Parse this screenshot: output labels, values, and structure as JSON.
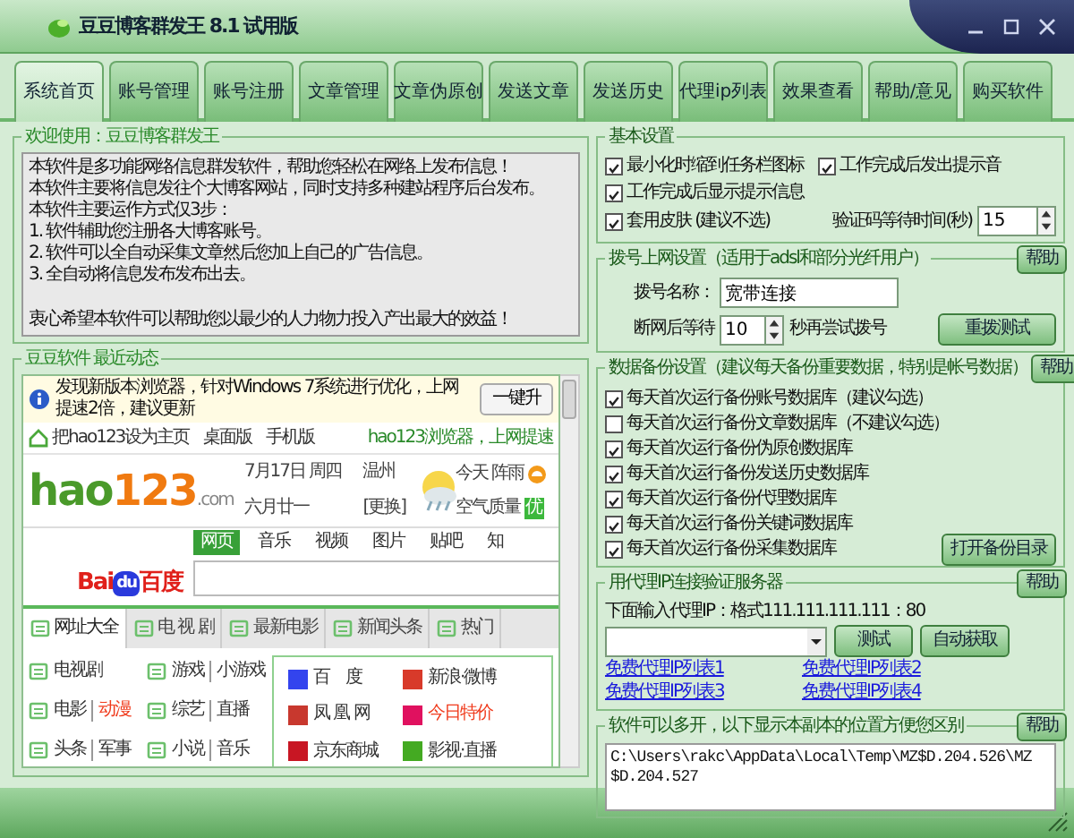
{
  "window": {
    "title": "豆豆博客群发王 8.1 试用版"
  },
  "tabs": [
    {
      "label": "系统首页",
      "selected": true
    },
    {
      "label": "账号管理",
      "selected": false
    },
    {
      "label": "账号注册",
      "selected": false
    },
    {
      "label": "文章管理",
      "selected": false
    },
    {
      "label": "文章伪原创",
      "selected": false
    },
    {
      "label": "发送文章",
      "selected": false
    },
    {
      "label": "发送历史",
      "selected": false
    },
    {
      "label": "代理ip列表",
      "selected": false
    },
    {
      "label": "效果查看",
      "selected": false
    },
    {
      "label": "帮助/意见",
      "selected": false
    },
    {
      "label": "购买软件",
      "selected": false
    }
  ],
  "welcome": {
    "title": "欢迎使用：豆豆博客群发王",
    "intro": [
      "本软件是多功能网络信息群发软件，帮助您轻松在网络上发布信息！",
      "本软件主要将信息发往个大博客网站，同时支持多种建站程序后台发布。",
      "本软件主要运作方式仅3步：",
      "1. 软件辅助您注册各大博客账号。",
      "2. 软件可以全自动采集文章然后您加上自己的广告信息。",
      "3. 全自动将信息发布发布出去。"
    ],
    "closing": "衷心希望本软件可以帮助您以最少的人力物力投入产出最大的效益！"
  },
  "news": {
    "title": "豆豆软件 最近动态",
    "info_bar": {
      "text": "发现新版本浏览器，针对Windows 7系统进行优化，上网提速2倍，建议更新",
      "button": "一键升"
    },
    "toolbar": {
      "home_link": "把hao123设为主页",
      "links": [
        "桌面版",
        "手机版"
      ],
      "promo": "hao123浏览器，上网提速"
    },
    "header": {
      "logo_word": "hao",
      "logo_number": "123",
      "logo_suffix": ".com",
      "date": "7月17日 周四",
      "city": "温州",
      "lunar": "六月廿一",
      "change": "[更换]",
      "weather": "今天 阵雨",
      "air_label": "空气质量",
      "air_value": "优"
    },
    "search": {
      "logo_latin": "Bai",
      "logo_paw": "du",
      "logo_cn": "百度",
      "tabs": [
        {
          "label": "网页",
          "selected": true
        },
        {
          "label": "音乐",
          "selected": false
        },
        {
          "label": "视频",
          "selected": false
        },
        {
          "label": "图片",
          "selected": false
        },
        {
          "label": "贴吧",
          "selected": false
        },
        {
          "label": "知",
          "selected": false
        }
      ]
    },
    "categories": [
      {
        "label": "网址大全",
        "selected": true
      },
      {
        "label": "电 视 剧",
        "selected": false
      },
      {
        "label": "最新电影",
        "selected": false
      },
      {
        "label": "新闻头条",
        "selected": false
      },
      {
        "label": "热门",
        "selected": false
      }
    ],
    "quick_links": [
      {
        "parts": [
          {
            "text": "电视剧",
            "hot": false
          }
        ]
      },
      {
        "parts": [
          {
            "text": "游戏",
            "hot": false
          },
          {
            "text": "小游戏",
            "hot": false
          }
        ]
      },
      {
        "parts": [
          {
            "text": "电影",
            "hot": false
          },
          {
            "text": "动漫",
            "hot": true
          }
        ]
      },
      {
        "parts": [
          {
            "text": "综艺",
            "hot": false
          },
          {
            "text": "直播",
            "hot": false
          }
        ]
      },
      {
        "parts": [
          {
            "text": "头条",
            "hot": false
          },
          {
            "text": "军事",
            "hot": false
          }
        ]
      },
      {
        "parts": [
          {
            "text": "小说",
            "hot": false
          },
          {
            "text": "音乐",
            "hot": false
          }
        ]
      }
    ],
    "sites": [
      {
        "text": "百　度",
        "hot": false,
        "color": "#3344ee"
      },
      {
        "text": "新浪·微博",
        "hot": false,
        "color": "#d83a2a"
      },
      {
        "text": "凤 凰 网",
        "hot": false,
        "color": "#c8382e"
      },
      {
        "text": "今日特价",
        "hot": true,
        "color": "#e0115f"
      },
      {
        "text": "京东商城",
        "hot": false,
        "color": "#c81623"
      },
      {
        "text": "影视·直播",
        "hot": false,
        "color": "#44aa22"
      }
    ]
  },
  "basic": {
    "title": "基本设置",
    "options": [
      {
        "label": "最小化时缩到任务栏图标",
        "checked": true
      },
      {
        "label": "工作完成后发出提示音",
        "checked": true
      },
      {
        "label": "工作完成后显示提示信息",
        "checked": true
      },
      {
        "label": "套用皮肤 (建议不选)",
        "checked": true
      }
    ],
    "captcha_label": "验证码等待时间(秒)",
    "captcha_value": "15"
  },
  "dial": {
    "title": "拨号上网设置（适用于adsl和部分光纤用户）",
    "help": "帮助",
    "name_label": "拨号名称：",
    "name_value": "宽带连接",
    "wait_label": "断网后等待",
    "wait_value": "10",
    "wait_suffix": "秒再尝试拨号",
    "redial": "重拨测试"
  },
  "backup": {
    "title": "数据备份设置（建议每天备份重要数据，特别是帐号数据）",
    "help": "帮助",
    "options": [
      {
        "label": "每天首次运行备份账号数据库（建议勾选）",
        "checked": true
      },
      {
        "label": "每天首次运行备份文章数据库（不建议勾选）",
        "checked": false
      },
      {
        "label": "每天首次运行备份伪原创数据库",
        "checked": true
      },
      {
        "label": "每天首次运行备份发送历史数据库",
        "checked": true
      },
      {
        "label": "每天首次运行备份代理数据库",
        "checked": true
      },
      {
        "label": "每天首次运行备份关键词数据库",
        "checked": true
      },
      {
        "label": "每天首次运行备份采集数据库",
        "checked": true
      }
    ],
    "open": "打开备份目录"
  },
  "proxy": {
    "title": "用代理IP连接验证服务器",
    "help": "帮助",
    "hint": "下面输入代理IP：格式111.111.111.111：80",
    "test": "测试",
    "auto": "自动获取",
    "links": [
      "免费代理IP列表1",
      "免费代理IP列表2",
      "免费代理IP列表3",
      "免费代理IP列表4"
    ]
  },
  "multi": {
    "title": "软件可以多开，以下显示本副本的位置方便您区别",
    "help": "帮助",
    "path": "C:\\Users\\rakc\\AppData\\Local\\Temp\\MZ$D.204.526\\MZ$D.204.527"
  }
}
